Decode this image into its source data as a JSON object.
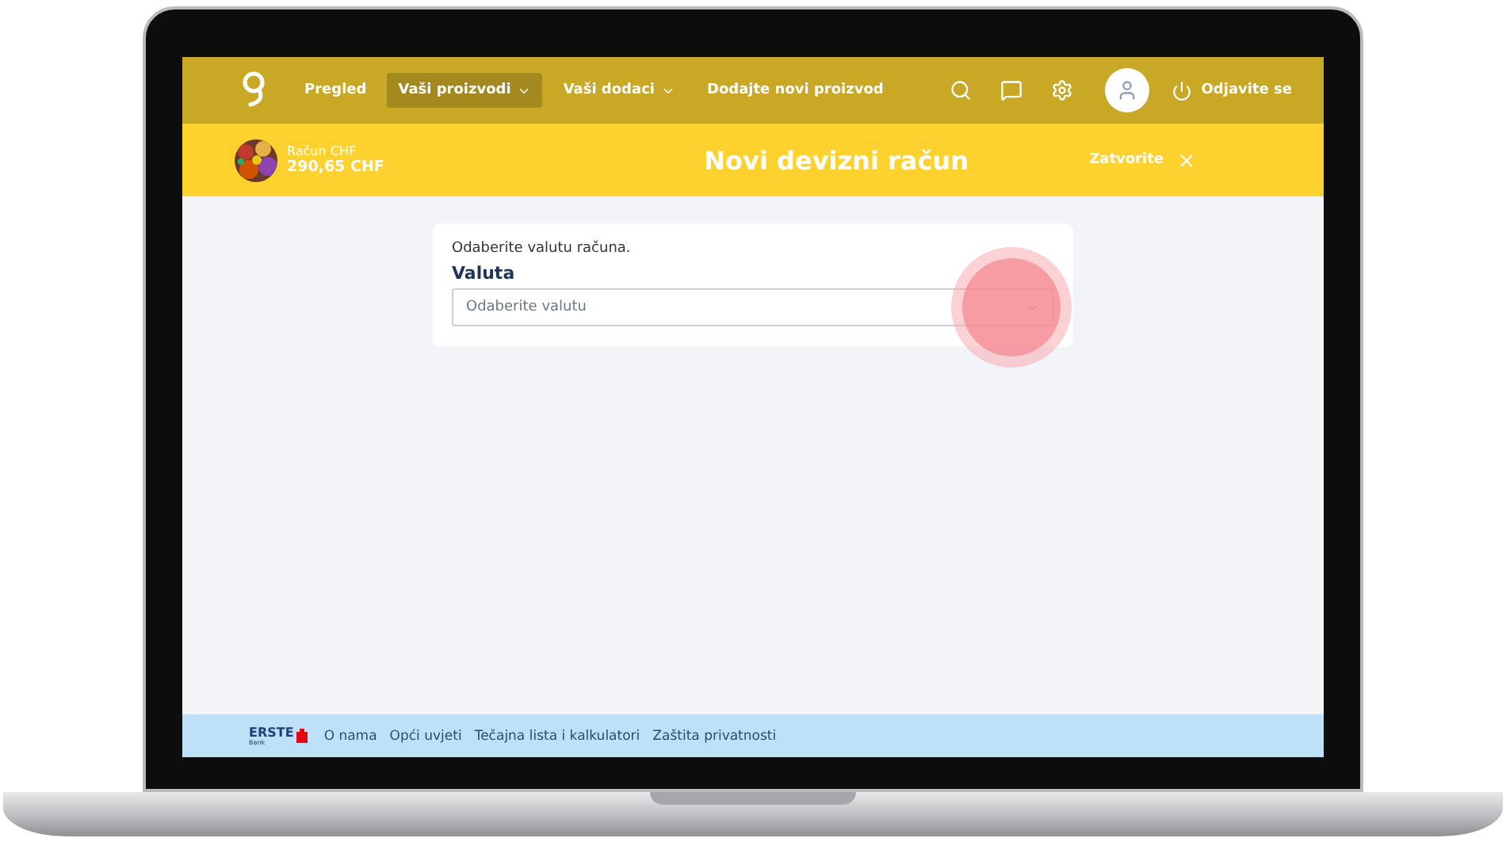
{
  "nav": {
    "items": [
      {
        "label": "Pregled",
        "selected": false,
        "dropdown": false
      },
      {
        "label": "Vaši proizvodi",
        "selected": true,
        "dropdown": true
      },
      {
        "label": "Vaši dodaci",
        "selected": false,
        "dropdown": true
      },
      {
        "label": "Dodajte novi proizvod",
        "selected": false,
        "dropdown": false
      }
    ],
    "logout": "Odjavite se"
  },
  "account": {
    "name": "Račun CHF",
    "balance": "290,65 CHF"
  },
  "page_title": "Novi devizni račun",
  "close": "Zatvorite",
  "form": {
    "hint": "Odaberite valutu računa.",
    "label": "Valuta",
    "select": {
      "placeholder": "Odaberite valutu"
    }
  },
  "footer": {
    "logo": "ERSTE",
    "logo_sub": "Bank",
    "links": [
      "O nama",
      "Opći uvjeti",
      "Tečajna lista i kalkulatori",
      "Zaštita privatnosti"
    ]
  }
}
